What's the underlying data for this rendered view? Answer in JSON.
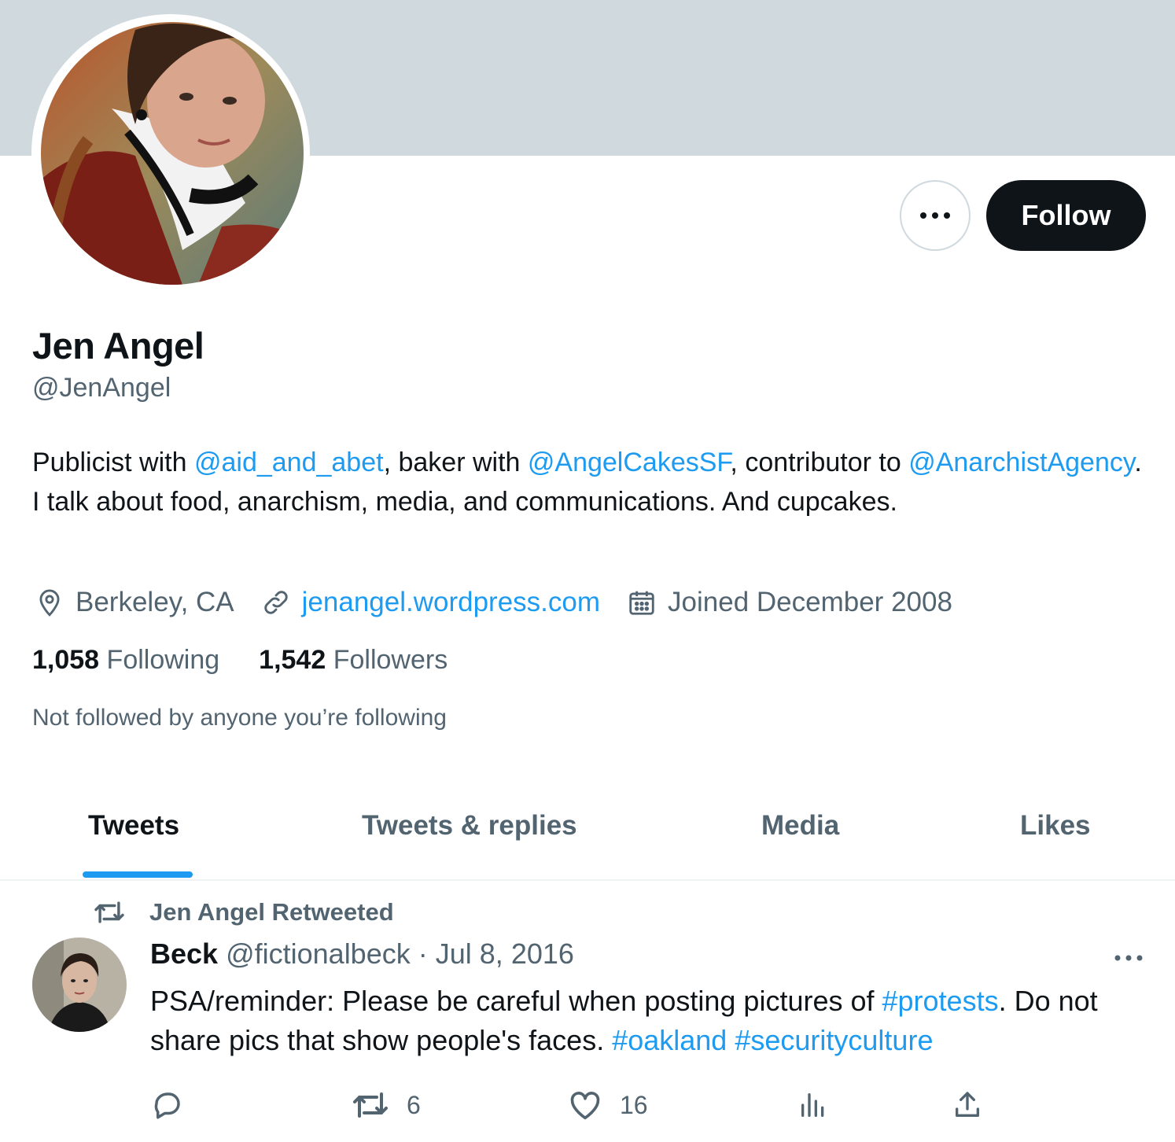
{
  "profile": {
    "name": "Jen Angel",
    "handle": "@JenAngel",
    "follow_label": "Follow",
    "bio": {
      "p1": "Publicist with ",
      "m1": "@aid_and_abet",
      "p2": ", baker with ",
      "m2": "@AngelCakesSF",
      "p3": ", contributor to ",
      "m3": "@AnarchistAgency",
      "p4": ". I talk about food, anarchism, media, and communications. And cupcakes."
    },
    "location": "Berkeley, CA",
    "website": "jenangel.wordpress.com",
    "joined": "Joined December 2008",
    "following_count": "1,058",
    "following_label": "Following",
    "followers_count": "1,542",
    "followers_label": "Followers",
    "not_followed": "Not followed by anyone you’re following",
    "icons": {
      "more": "more-horizontal-icon",
      "location": "location-pin-icon",
      "link": "link-icon",
      "calendar": "calendar-icon"
    }
  },
  "tabs": [
    "Tweets",
    "Tweets & replies",
    "Media",
    "Likes"
  ],
  "tweet": {
    "retweet_label": "Jen Angel Retweeted",
    "author_name": "Beck",
    "author_handle": "@fictionalbeck",
    "separator": "·",
    "date": "Jul 8, 2016",
    "text": {
      "t1": "PSA/reminder: Please be careful when posting pictures of ",
      "h1": "#protests",
      "t2": ". Do not share pics that show people's faces. ",
      "h2": "#oakland",
      "t3": " ",
      "h3": "#securityculture"
    },
    "retweet_count": "6",
    "like_count": "16",
    "icons": [
      "reply-icon",
      "retweet-icon",
      "like-icon",
      "views-icon",
      "share-icon"
    ]
  },
  "colors": {
    "banner": "#cfd9de",
    "link": "#1d9bf0",
    "text": "#0f1419",
    "secondary": "#536471"
  }
}
